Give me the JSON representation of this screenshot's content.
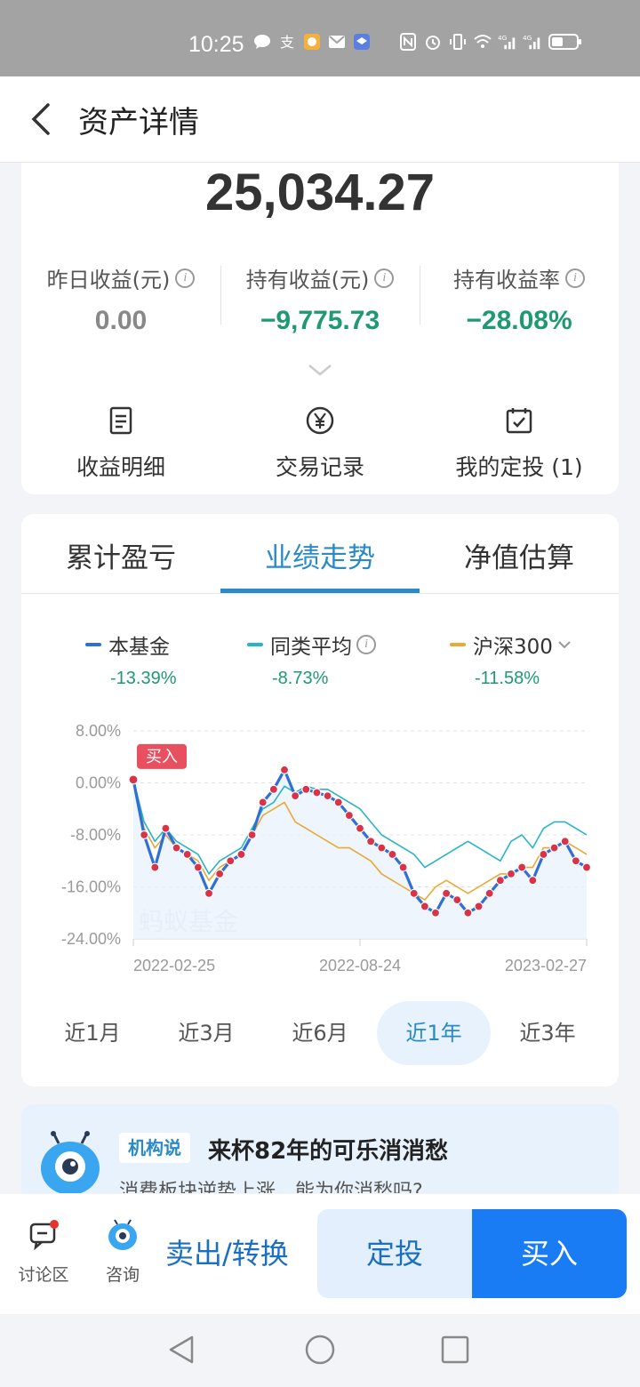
{
  "status": {
    "time": "10:25",
    "icons_left": [
      "chat-icon",
      "alipay-icon",
      "app-icon-orange",
      "mail-icon",
      "app-icon-blue"
    ],
    "icons_right": [
      "nfc-icon",
      "alarm-icon",
      "vibrate-icon",
      "wifi-icon",
      "signal-4g-icon",
      "signal-4g-icon",
      "battery-icon"
    ]
  },
  "nav": {
    "title": "资产详情"
  },
  "summary": {
    "total": "25,034.27",
    "stats": [
      {
        "label": "昨日收益(元)",
        "value": "0.00",
        "color": "#888888"
      },
      {
        "label": "持有收益(元)",
        "value": "−9,775.73",
        "color": "#1f9a70"
      },
      {
        "label": "持有收益率",
        "value": "−28.08%",
        "color": "#1f9a70"
      }
    ],
    "actions": [
      {
        "label": "收益明细",
        "icon": "document-icon"
      },
      {
        "label": "交易记录",
        "icon": "yen-icon"
      },
      {
        "label": "我的定投 (1)",
        "icon": "calendar-check-icon"
      }
    ]
  },
  "tabs": [
    "累计盈亏",
    "业绩走势",
    "净值估算"
  ],
  "active_tab": 1,
  "legend": [
    {
      "name": "本基金",
      "pct": "-13.39%",
      "color": "#2f6fd6"
    },
    {
      "name": "同类平均",
      "pct": "-8.73%",
      "color": "#29b3c9"
    },
    {
      "name": "沪深300",
      "pct": "-11.58%",
      "color": "#e8a935"
    }
  ],
  "chart_data": {
    "type": "line",
    "ylim": [
      -24,
      8
    ],
    "yticks": [
      "8.00%",
      "0.00%",
      "-8.00%",
      "-16.00%",
      "-24.00%"
    ],
    "xticks": [
      "2022-02-25",
      "2022-08-24",
      "2023-02-27"
    ],
    "watermark": "蚂蚁基金",
    "buy_marker": "买入",
    "series": [
      {
        "name": "本基金",
        "color": "#2f6fd6",
        "values": [
          0.5,
          -8,
          -13,
          -7,
          -10,
          -11,
          -13,
          -17,
          -14,
          -12,
          -11,
          -8,
          -3,
          -1,
          2,
          -2,
          -1,
          -1.5,
          -2,
          -3,
          -5,
          -7,
          -9,
          -10,
          -11,
          -13,
          -17,
          -19,
          -20,
          -17,
          -18,
          -20,
          -19,
          -17,
          -15,
          -14,
          -13,
          -15,
          -11,
          -10,
          -9,
          -12,
          -13
        ]
      },
      {
        "name": "同类平均",
        "color": "#29b3c9",
        "values": [
          0.5,
          -6,
          -9,
          -7,
          -9,
          -10,
          -11,
          -14,
          -12,
          -11,
          -10,
          -7,
          -4,
          -3,
          -0.5,
          -1.5,
          -0.5,
          -1,
          -1,
          -2,
          -3,
          -4,
          -6,
          -8,
          -9,
          -10,
          -11,
          -13,
          -12,
          -11,
          -10,
          -9,
          -10,
          -11,
          -12,
          -9,
          -8,
          -10,
          -7,
          -6,
          -6,
          -7,
          -8
        ]
      },
      {
        "name": "沪深300",
        "color": "#e8a935",
        "values": [
          0.5,
          -7,
          -10,
          -8,
          -10,
          -11,
          -12,
          -15,
          -13,
          -12,
          -11,
          -8,
          -5,
          -4,
          -3,
          -6,
          -7,
          -8,
          -9,
          -10,
          -10,
          -11,
          -12,
          -14,
          -15,
          -16,
          -17,
          -18,
          -16,
          -15,
          -16,
          -17,
          -16,
          -15,
          -14,
          -14,
          -13,
          -13,
          -10,
          -10,
          -9,
          -10,
          -11
        ]
      }
    ]
  },
  "ranges": [
    "近1月",
    "近3月",
    "近6月",
    "近1年",
    "近3年"
  ],
  "active_range": 3,
  "promo": {
    "tag": "机构说",
    "title": "来杯82年的可乐消消愁",
    "subtitle": "消费板块逆势上涨，能为你消愁吗?"
  },
  "bottom": {
    "discuss": "讨论区",
    "consult": "咨询",
    "sell": "卖出/转换",
    "dca": "定投",
    "buy": "买入"
  }
}
